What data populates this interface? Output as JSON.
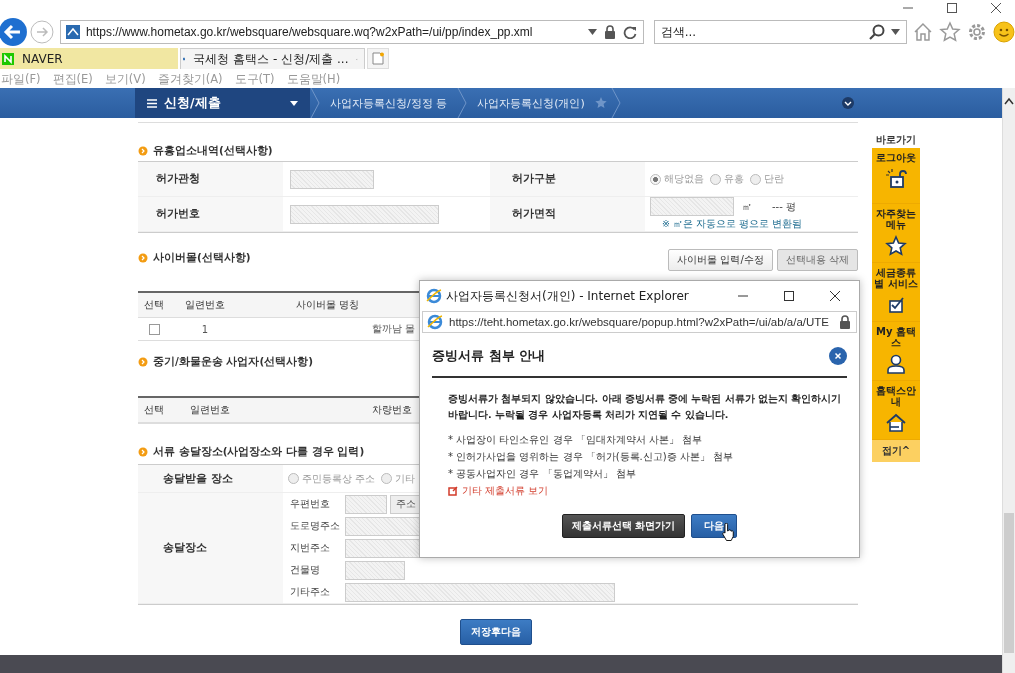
{
  "browser": {
    "url": "https://www.hometax.go.kr/websquare/websquare.wq?w2xPath=/ui/pp/index_pp.xml",
    "search_placeholder": "검색...",
    "tabs": [
      {
        "label": "NAVER",
        "selected": false
      },
      {
        "label": "국세청 홈택스 - 신청/제출 ...",
        "selected": true
      }
    ],
    "menu": [
      "파일(F)",
      "편집(E)",
      "보기(V)",
      "즐겨찾기(A)",
      "도구(T)",
      "도움말(H)"
    ]
  },
  "nav": {
    "menu": "신청/제출",
    "breadcrumbs": [
      "사업자등록신청/정정 등",
      "사업자등록신청(개인)"
    ]
  },
  "license": {
    "title": "유흥업소내역(선택사항)",
    "authority_label": "허가관청",
    "type_label": "허가구분",
    "type_options": [
      {
        "label": "해당없음",
        "selected": true
      },
      {
        "label": "유흥",
        "selected": false
      },
      {
        "label": "단란",
        "selected": false
      }
    ],
    "number_label": "허가번호",
    "area_label": "허가면적",
    "area_unit": "㎡",
    "pyeong": "--- 평",
    "area_note": "※ ㎡은 자동으로 평으로 변환됨"
  },
  "cybermall": {
    "title": "사이버몰(선택사항)",
    "buttons": [
      {
        "label": "사이버몰 입력/수정",
        "disabled": false
      },
      {
        "label": "선택내용 삭제",
        "disabled": true
      }
    ],
    "columns": [
      "선택",
      "일련번호",
      "사이버몰 명칭"
    ],
    "rows": [
      {
        "checked": false,
        "number": "1",
        "name": "할까남 몰"
      }
    ]
  },
  "trucking": {
    "title": "중기/화물운송 사업자(선택사항)",
    "columns": [
      "선택",
      "일련번호",
      "차량번호"
    ]
  },
  "delivery": {
    "title": "서류 송달장소(사업장소와 다를 경우 입력)",
    "place_label": "송달받을 장소",
    "place_options": [
      {
        "label": "주민등록상 주소",
        "selected": false
      },
      {
        "label": "기타",
        "selected": false
      }
    ],
    "address_label": "송달장소",
    "address_fields": [
      {
        "label": "우편번호",
        "kind": "zip",
        "button": "주소"
      },
      {
        "label": "도로명주소",
        "kind": "wide"
      },
      {
        "label": "지번주소",
        "kind": "wide"
      },
      {
        "label": "건물명",
        "kind": "short"
      },
      {
        "label": "기타주소",
        "kind": "full"
      }
    ]
  },
  "save_button": "저장후다음",
  "quick_menu": {
    "title": "바로가기",
    "items": [
      {
        "label": "로그아웃",
        "kind": "lock"
      },
      {
        "label": "자주찾는 메뉴",
        "kind": "star"
      },
      {
        "label": "세금종류별 서비스",
        "kind": "check"
      },
      {
        "label": "My 홈택스",
        "kind": "person"
      },
      {
        "label": "홈택스안내",
        "kind": "house"
      }
    ],
    "collapse": "접기^"
  },
  "popup": {
    "window_title": "사업자등록신청서(개인) - Internet Explorer",
    "url": "https://teht.hometax.go.kr/websquare/popup.html?w2xPath=/ui/ab/a/a/UTE",
    "heading": "증빙서류 첨부 안내",
    "message": "증빙서류가 첨부되지 않았습니다. 아래 증빙서류 중에 누락된 서류가 없는지 확인하시기 바랍니다. 누락될 경우 사업자등록 처리가 지연될 수 있습니다.",
    "bullets": [
      "* 사업장이 타인소유인 경우 「임대차계약서 사본」 첨부",
      "* 인허가사업을 영위하는 경우 「허가(등록.신고)증 사본」 첨부",
      "* 공동사업자인 경우 「동업계약서」 첨부"
    ],
    "link": "기타 제출서류 보기",
    "buttons": [
      {
        "label": "제출서류선택 화면가기",
        "kind": "dark"
      },
      {
        "label": "다음",
        "kind": "primary"
      }
    ]
  }
}
